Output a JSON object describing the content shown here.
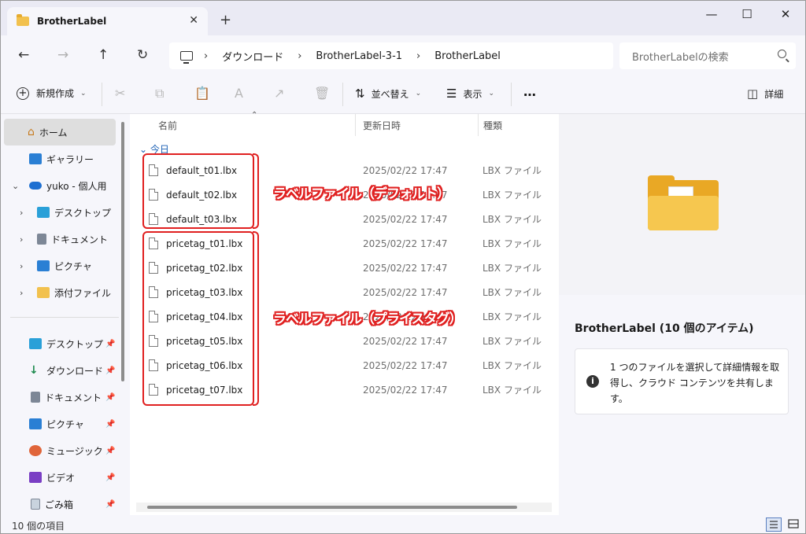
{
  "window": {
    "tab_title": "BrotherLabel",
    "tab_close": "✕",
    "new_tab": "+",
    "controls": {
      "minimize": "—",
      "maximize": "☐",
      "close": "✕"
    }
  },
  "nav": {
    "back": "←",
    "forward": "→",
    "up": "↑",
    "refresh": "↻",
    "breadcrumbs": [
      "ダウンロード",
      "BrotherLabel-3-1",
      "BrotherLabel"
    ],
    "crumb_separator": "›",
    "search_placeholder": "BrotherLabelの検索"
  },
  "toolbar": {
    "new_label": "新規作成",
    "new_icon": "+",
    "cut_icon": "✂",
    "copy_icon": "⧉",
    "paste_icon": "📋",
    "rename_icon": "A",
    "share_icon": "↗",
    "delete_icon": "🗑",
    "sort_icon": "⇅",
    "sort_label": "並べ替え",
    "view_icon": "☰",
    "view_label": "表示",
    "more_label": "…",
    "details_icon": "◫",
    "details_label": "詳細",
    "caret": "⌄"
  },
  "sidebar": {
    "home": "ホーム",
    "gallery": "ギャラリー",
    "onedrive": "yuko - 個人用",
    "onedrive_children": [
      "デスクトップ",
      "ドキュメント",
      "ピクチャ",
      "添付ファイル"
    ],
    "quick_access": [
      "デスクトップ",
      "ダウンロード",
      "ドキュメント",
      "ピクチャ",
      "ミュージック",
      "ビデオ",
      "ごみ箱"
    ],
    "pin": "📌",
    "chevron_right": "›",
    "chevron_down": "⌄"
  },
  "columns": {
    "name": "名前",
    "modified": "更新日時",
    "type": "種類",
    "sort_arrow": "⌃"
  },
  "group": {
    "label": "今日",
    "chevron": "⌄"
  },
  "files": [
    {
      "name": "default_t01.lbx",
      "date": "2025/02/22 17:47",
      "type": "LBX ファイル"
    },
    {
      "name": "default_t02.lbx",
      "date": "2025/02/22 17:47",
      "type": "LBX ファイル"
    },
    {
      "name": "default_t03.lbx",
      "date": "2025/02/22 17:47",
      "type": "LBX ファイル"
    },
    {
      "name": "pricetag_t01.lbx",
      "date": "2025/02/22 17:47",
      "type": "LBX ファイル"
    },
    {
      "name": "pricetag_t02.lbx",
      "date": "2025/02/22 17:47",
      "type": "LBX ファイル"
    },
    {
      "name": "pricetag_t03.lbx",
      "date": "2025/02/22 17:47",
      "type": "LBX ファイル"
    },
    {
      "name": "pricetag_t04.lbx",
      "date": "2025/02/22 17:47",
      "type": "LBX ファイル"
    },
    {
      "name": "pricetag_t05.lbx",
      "date": "2025/02/22 17:47",
      "type": "LBX ファイル"
    },
    {
      "name": "pricetag_t06.lbx",
      "date": "2025/02/22 17:47",
      "type": "LBX ファイル"
    },
    {
      "name": "pricetag_t07.lbx",
      "date": "2025/02/22 17:47",
      "type": "LBX ファイル"
    }
  ],
  "annotations": {
    "default_label": "ラベルファイル（デフォルト）",
    "pricetag_label": "ラベルファイル（プライスタグ）",
    "color": "#e02020"
  },
  "details": {
    "title": "BrotherLabel (10 個のアイテム)",
    "info_icon": "i",
    "info_text": "1 つのファイルを選択して詳細情報を取得し、クラウド コンテンツを共有します。"
  },
  "status": {
    "count": "10 個の項目"
  }
}
